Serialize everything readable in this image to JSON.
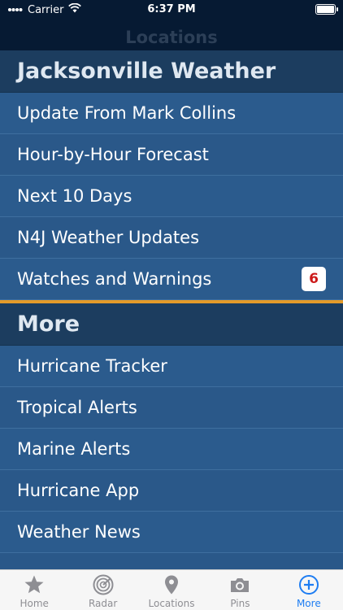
{
  "status_bar": {
    "carrier": "Carrier",
    "time": "6:37 PM"
  },
  "nav": {
    "title": "Locations"
  },
  "sections": [
    {
      "header": "Jacksonville Weather",
      "rows": [
        {
          "label": "Update From Mark Collins"
        },
        {
          "label": "Hour-by-Hour Forecast"
        },
        {
          "label": "Next 10 Days"
        },
        {
          "label": "N4J Weather Updates"
        },
        {
          "label": "Watches and Warnings",
          "badge": "6"
        }
      ]
    },
    {
      "header": "More",
      "rows": [
        {
          "label": "Hurricane Tracker"
        },
        {
          "label": "Tropical Alerts"
        },
        {
          "label": "Marine Alerts"
        },
        {
          "label": "Hurricane App"
        },
        {
          "label": "Weather News"
        }
      ]
    }
  ],
  "tabs": [
    {
      "label": "Home",
      "icon": "star-icon"
    },
    {
      "label": "Radar",
      "icon": "radar-icon"
    },
    {
      "label": "Locations",
      "icon": "location-pin-icon"
    },
    {
      "label": "Pins",
      "icon": "camera-icon"
    },
    {
      "label": "More",
      "icon": "plus-circle-icon",
      "active": true
    }
  ],
  "colors": {
    "accent": "#1e7df2",
    "badge_text": "#cc1a1a",
    "section_divider": "#e49b2a"
  }
}
